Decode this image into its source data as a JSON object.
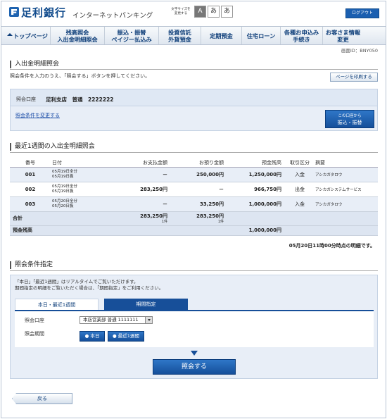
{
  "header": {
    "logo": "足利銀行",
    "logo_sub": "インターネットバンキング",
    "font_size_label": "文字サイズを\n変更する",
    "font_sizes": [
      "A",
      "あ",
      "あ"
    ],
    "logout": "ログアウト"
  },
  "nav": [
    "トップページ",
    "残高照会\n入出金明細照会",
    "振込・振替\nペイジー払込み",
    "投資信託\n外貨預金",
    "定期預金",
    "住宅ローン",
    "各種お申込み\n手続き",
    "お客さま情報\n変更"
  ],
  "screen_id": "画面ID：BNY050",
  "page_title": "入出金明細照会",
  "instruction": "照会条件を入力のうえ、「照会する」ボタンを押してください。",
  "print_button": "ページを印刷する",
  "account": {
    "label": "照会口座",
    "value": "足利支店　普通　2222222",
    "change_link": "照会条件を変更する",
    "transfer_button_line1": "この口座から",
    "transfer_button_line2": "振込・振替"
  },
  "details_title": "最近1週間の入出金明細照会",
  "table": {
    "headers": [
      "番号",
      "日付",
      "お支払金額",
      "お預り金額",
      "預金残高",
      "取引区分",
      "摘要"
    ],
    "rows": [
      {
        "no": "001",
        "date1": "05月19日全分",
        "date2": "05月19日扱",
        "pay": "－",
        "deposit": "250,000円",
        "balance": "1,250,000円",
        "type": "入金",
        "desc": "アシカガタロウ"
      },
      {
        "no": "002",
        "date1": "05月19日全分",
        "date2": "05月19日扱",
        "pay": "283,250円",
        "deposit": "－",
        "balance": "966,750円",
        "type": "出金",
        "desc": "アシカガシステムサービス"
      },
      {
        "no": "003",
        "date1": "05月20日全分",
        "date2": "05月20日扱",
        "pay": "－",
        "deposit": "33,250円",
        "balance": "1,000,000円",
        "type": "入金",
        "desc": "アシカガタロウ"
      }
    ],
    "total_label": "合計",
    "total_pay": "283,250円",
    "total_pay_count": "1件",
    "total_deposit": "283,250円",
    "total_deposit_count": "1件",
    "balance_label": "預金残高",
    "balance_value": "1,000,000円"
  },
  "timestamp": "05月20日11時00分時点の明細です。",
  "conditions": {
    "title": "照会条件指定",
    "note_line1": "「本日」「最近1週間」はリアルタイムでご覧いただけます。",
    "note_line2": "期間指定の明細をご覧いただく場合は、「期間指定」をご利用ください。",
    "tab_active": "本日・最近1週間",
    "tab_inactive": "期間指定",
    "account_label": "照会口座",
    "account_value": "本店営業部 普通 1111111",
    "period_label": "照会期間",
    "period_today": "本日",
    "period_week": "最近1週間",
    "search_button": "照会する"
  },
  "back_button": "戻る"
}
